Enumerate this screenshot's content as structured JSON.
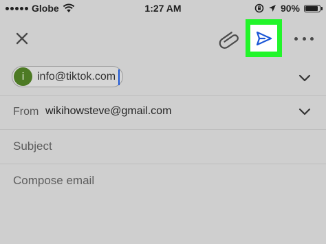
{
  "status_bar": {
    "carrier": "Globe",
    "time": "1:27 AM",
    "battery": "90%",
    "battery_level": 0.9
  },
  "toolbar": {
    "icons": [
      "close-icon",
      "attachment-icon",
      "send-icon",
      "more-icon"
    ],
    "highlight_color": "#22f52a",
    "send_icon_color": "#1a56d6"
  },
  "to": {
    "chip_initial": "i",
    "chip_email": "info@tiktok.com",
    "avatar_color": "#4d7a24"
  },
  "from": {
    "label": "From",
    "email": "wikihowsteve@gmail.com"
  },
  "subject": {
    "placeholder": "Subject",
    "value": ""
  },
  "body": {
    "placeholder": "Compose email",
    "value": ""
  }
}
